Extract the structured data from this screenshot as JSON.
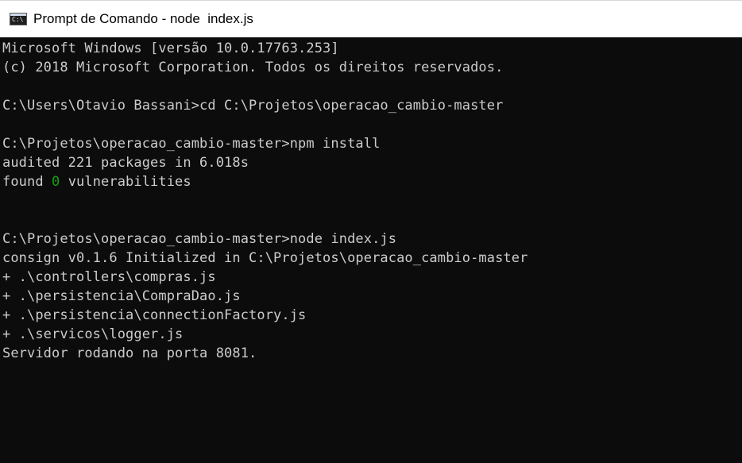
{
  "window": {
    "title": "Prompt de Comando - node  index.js",
    "icon": "cmd-icon",
    "icon_glyph": "C:\\"
  },
  "console": {
    "lines": [
      "Microsoft Windows [versão 10.0.17763.253]",
      "(c) 2018 Microsoft Corporation. Todos os direitos reservados.",
      "",
      "C:\\Users\\Otavio Bassani>cd C:\\Projetos\\operacao_cambio-master",
      "",
      "C:\\Projetos\\operacao_cambio-master>npm install",
      "audited 221 packages in 6.018s"
    ],
    "vuln_prefix": "found ",
    "vuln_count": "0",
    "vuln_suffix": " vulnerabilities",
    "lines2": [
      "",
      "",
      "C:\\Projetos\\operacao_cambio-master>node index.js",
      "consign v0.1.6 Initialized in C:\\Projetos\\operacao_cambio-master",
      "+ .\\controllers\\compras.js",
      "+ .\\persistencia\\CompraDao.js",
      "+ .\\persistencia\\connectionFactory.js",
      "+ .\\servicos\\logger.js",
      "Servidor rodando na porta 8081."
    ]
  },
  "colors": {
    "background": "#0c0c0c",
    "text": "#cccccc",
    "highlight": "#13a10e",
    "titlebar": "#ffffff"
  }
}
